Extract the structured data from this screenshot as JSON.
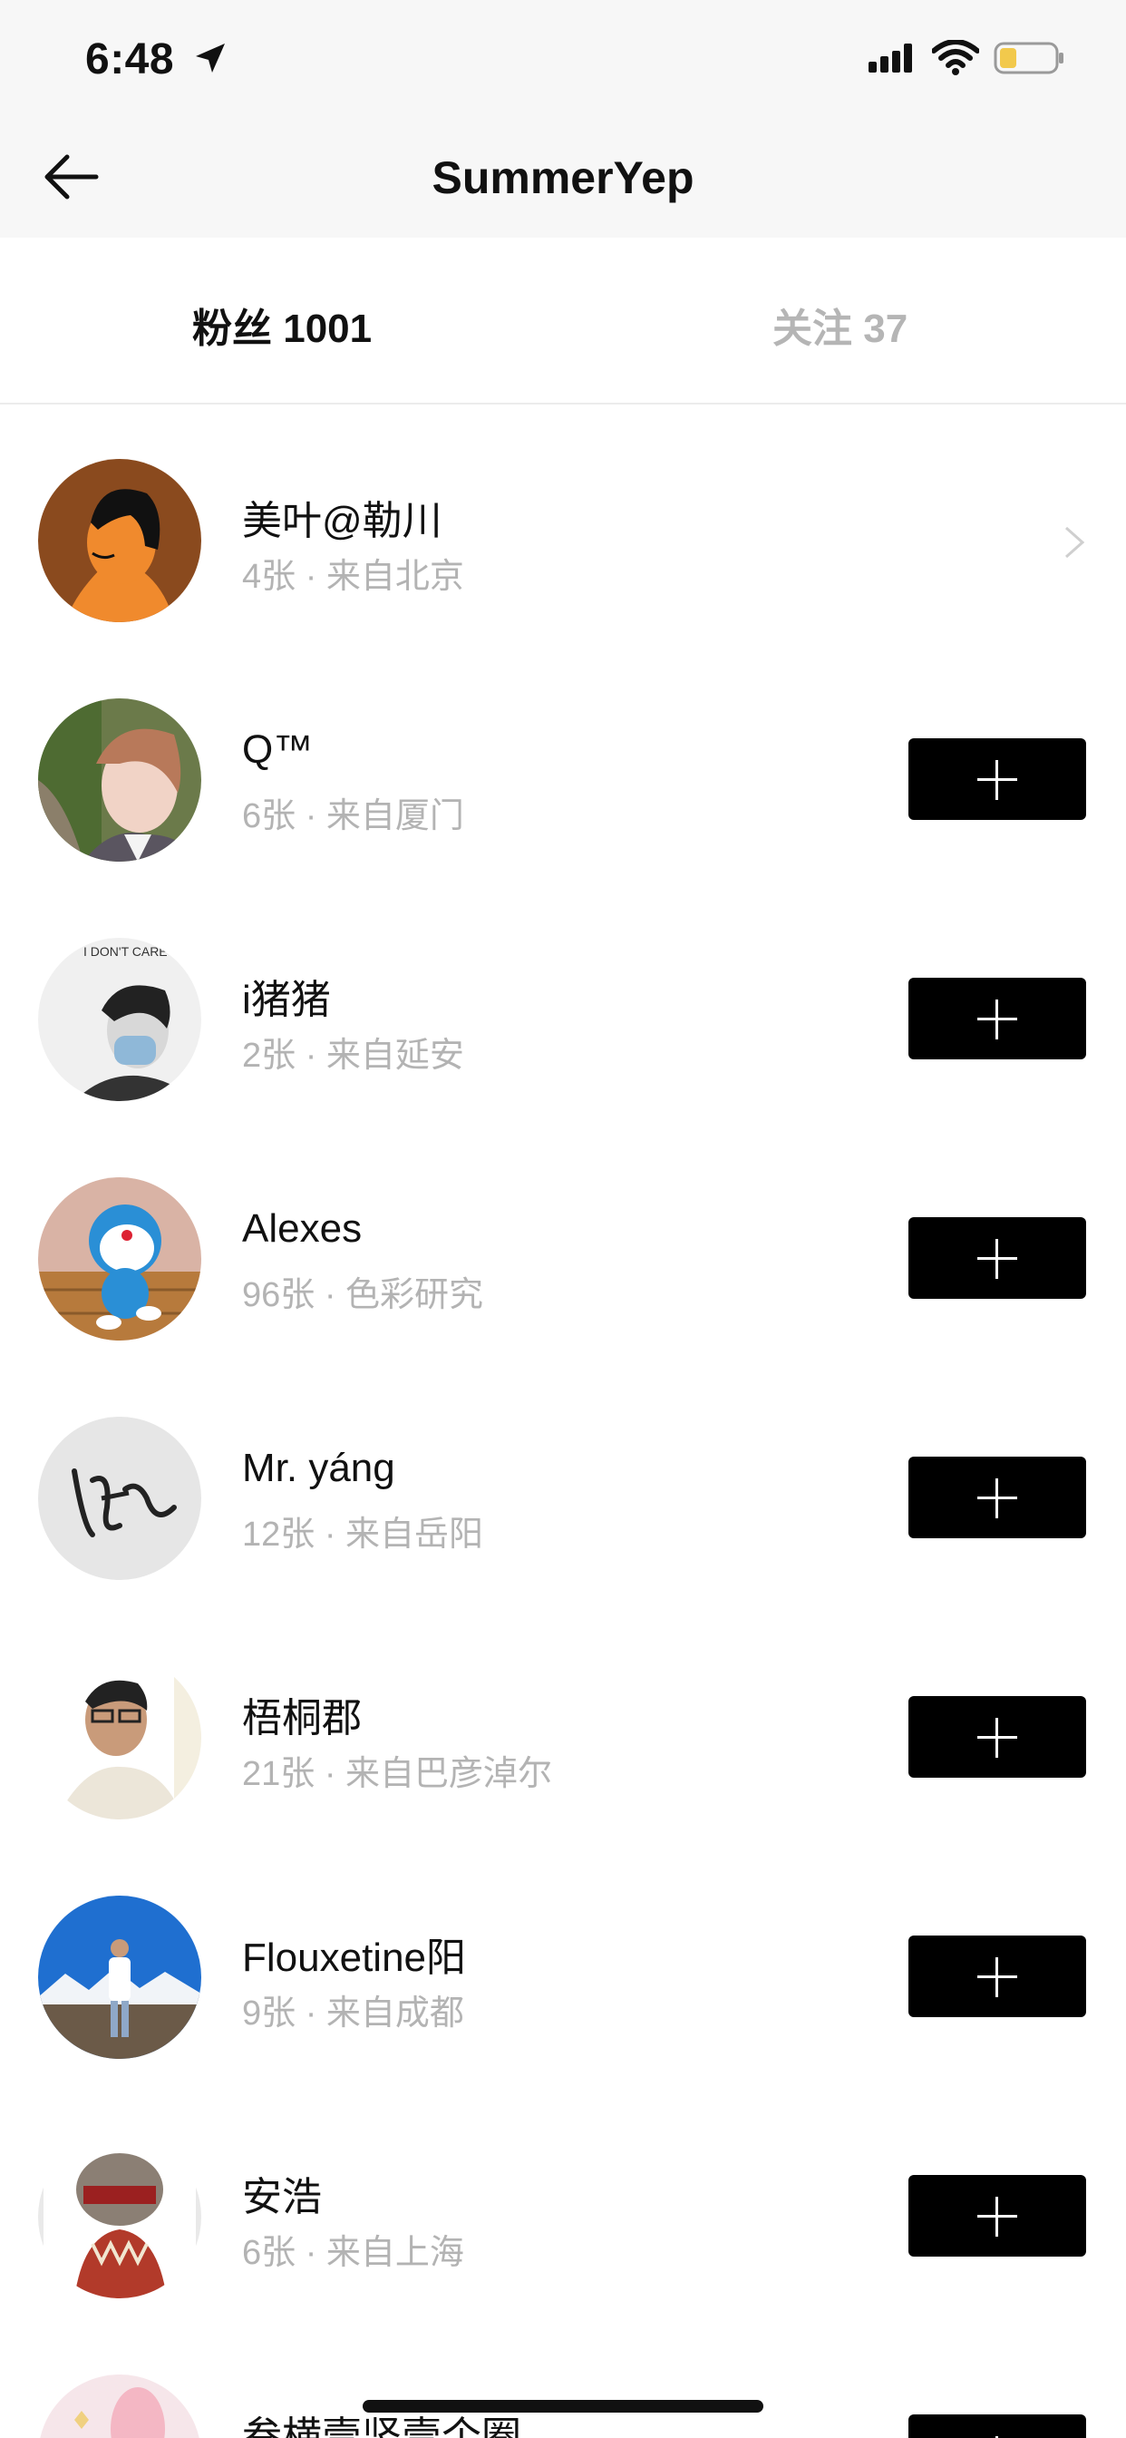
{
  "status": {
    "time": "6:48"
  },
  "header": {
    "title": "SummerYep"
  },
  "tabs": [
    {
      "label": "粉丝 1001",
      "active": true
    },
    {
      "label": "关注 37",
      "active": false
    }
  ],
  "followers": [
    {
      "name": "美叶@勒川",
      "sub": "4张 · 来自北京",
      "action": "chevron"
    },
    {
      "name": "Q™",
      "sub": "6张 · 来自厦门",
      "action": "follow"
    },
    {
      "name": "i猪猪",
      "sub": "2张 · 来自延安",
      "action": "follow"
    },
    {
      "name": "Alexes",
      "sub": "96张 · 色彩研究",
      "action": "follow"
    },
    {
      "name": "Mr. yáng",
      "sub": "12张 · 来自岳阳",
      "action": "follow"
    },
    {
      "name": "梧桐郡",
      "sub": "21张 · 来自巴彦淖尔",
      "action": "follow"
    },
    {
      "name": "Flouxetine阳",
      "sub": "9张 · 来自成都",
      "action": "follow"
    },
    {
      "name": "安浩",
      "sub": "6张 · 来自上海",
      "action": "follow"
    },
    {
      "name": "叁横壹竖壹个圈",
      "sub": "",
      "action": "follow"
    }
  ],
  "avatar_texts": {
    "tshirt_text": "I DON'T CARE"
  }
}
